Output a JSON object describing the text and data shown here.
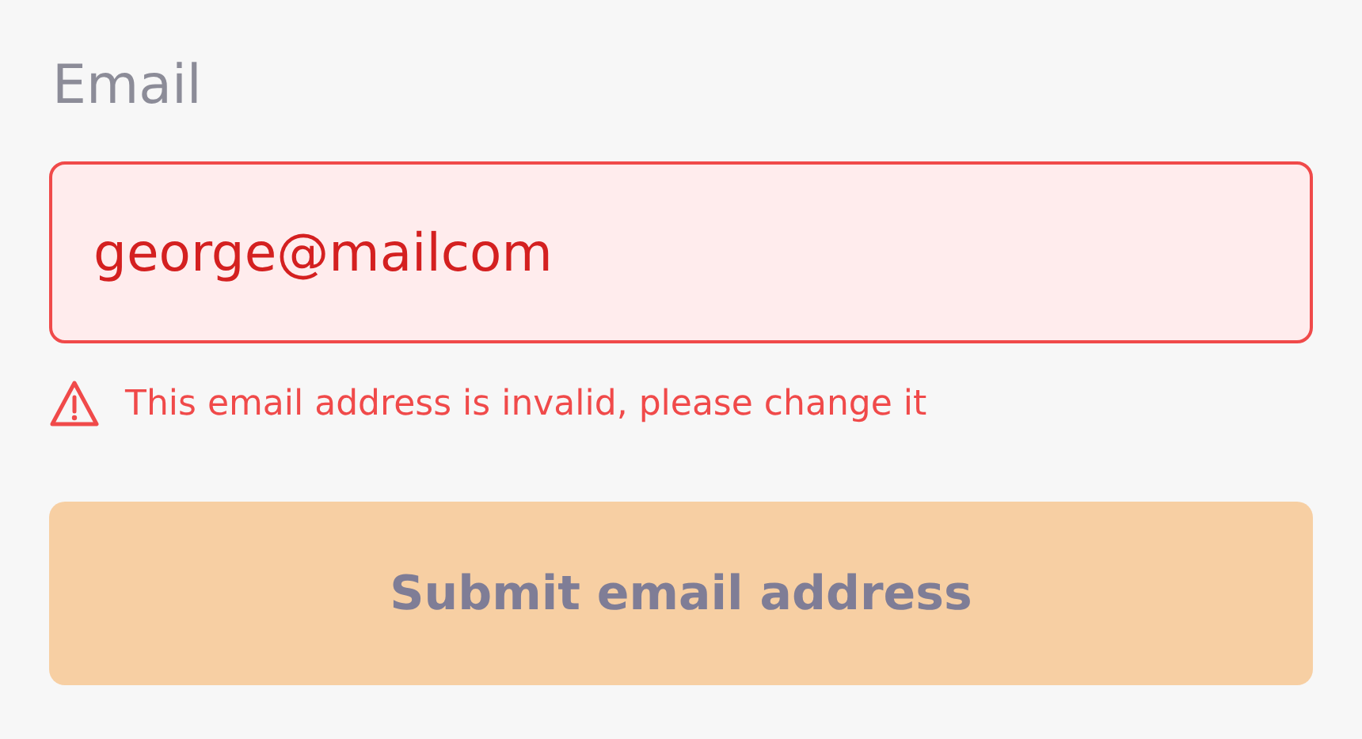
{
  "field": {
    "label": "Email",
    "value": "george@mailcom",
    "invalid": true,
    "error": "This email address is invalid, please change it"
  },
  "button": {
    "label": "Submit email address",
    "disabled": true
  }
}
